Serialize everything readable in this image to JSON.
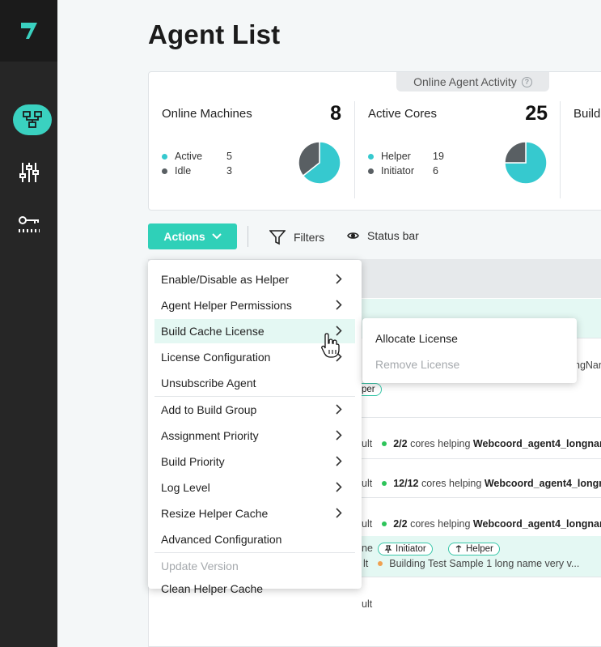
{
  "page": {
    "title": "Agent List"
  },
  "stats": {
    "tab_label": "Online Agent Activity",
    "cards": [
      {
        "title": "Online Machines",
        "total": "8",
        "legend": [
          {
            "label": "Active",
            "value": "5",
            "color": "#36c9cf"
          },
          {
            "label": "Idle",
            "value": "3",
            "color": "#595f63"
          }
        ]
      },
      {
        "title": "Active Cores",
        "total": "25",
        "legend": [
          {
            "label": "Helper",
            "value": "19",
            "color": "#36c9cf"
          },
          {
            "label": "Initiator",
            "value": "6",
            "color": "#595f63"
          }
        ]
      },
      {
        "title": "Build"
      }
    ]
  },
  "toolbar": {
    "actions_label": "Actions",
    "filters_label": "Filters",
    "status_bar_label": "Status bar"
  },
  "menu": {
    "items": [
      "Enable/Disable as Helper",
      "Agent Helper Permissions",
      "Build Cache License",
      "License Configuration",
      "Unsubscribe Agent",
      "Add to Build Group",
      "Assignment Priority",
      "Build Priority",
      "Log Level",
      "Resize Helper Cache",
      "Advanced Configuration",
      "Update Version",
      "Clean Helper Cache"
    ],
    "submenu": [
      "Allocate License",
      "Remove License"
    ]
  },
  "rows": {
    "r1_name_fragment": "ngNar",
    "r1_tag": "per",
    "r2_status": "ult",
    "r2_cores": "2/2",
    "r2_text": "cores helping",
    "r2_agent": "Webcoord_agent4_longnam",
    "r3_status": "ult",
    "r3_cores": "12/12",
    "r3_text": "cores helping",
    "r3_agent": "Webcoord_agent4_longnar",
    "r4_status": "ult",
    "r4_cores": "2/2",
    "r4_text": "cores helping",
    "r4_agent": "Webcoord_agent4_longnam",
    "r5_name_fragment": "ne",
    "r5_tag_initiator": "Initiator",
    "r5_tag_helper": "Helper",
    "r5_status": "lt",
    "r5_building": "Building Test Sample 1 long name very v...",
    "r6_status": "ult"
  },
  "colors": {
    "accent": "#2fd0b8",
    "sidebar": "#262626",
    "pie_primary": "#36c9cf",
    "pie_secondary": "#595f63"
  }
}
